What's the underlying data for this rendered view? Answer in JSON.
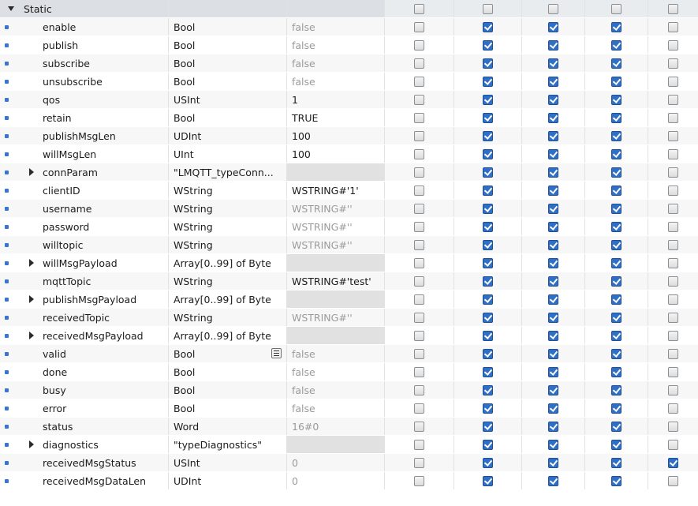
{
  "section": {
    "label": "Static"
  },
  "header_checks": [
    false,
    false,
    false,
    false,
    false
  ],
  "rows": [
    {
      "name": "enable",
      "type": "Bool",
      "default": "false",
      "def_style": "grey",
      "expandable": false,
      "checks": [
        false,
        true,
        true,
        true,
        false
      ]
    },
    {
      "name": "publish",
      "type": "Bool",
      "default": "false",
      "def_style": "grey",
      "expandable": false,
      "checks": [
        false,
        true,
        true,
        true,
        false
      ]
    },
    {
      "name": "subscribe",
      "type": "Bool",
      "default": "false",
      "def_style": "grey",
      "expandable": false,
      "checks": [
        false,
        true,
        true,
        true,
        false
      ]
    },
    {
      "name": "unsubscribe",
      "type": "Bool",
      "default": "false",
      "def_style": "grey",
      "expandable": false,
      "checks": [
        false,
        true,
        true,
        true,
        false
      ]
    },
    {
      "name": "qos",
      "type": "USInt",
      "default": "1",
      "def_style": "dark",
      "expandable": false,
      "checks": [
        false,
        true,
        true,
        true,
        false
      ]
    },
    {
      "name": "retain",
      "type": "Bool",
      "default": "TRUE",
      "def_style": "dark",
      "expandable": false,
      "checks": [
        false,
        true,
        true,
        true,
        false
      ]
    },
    {
      "name": "publishMsgLen",
      "type": "UDInt",
      "default": "100",
      "def_style": "dark",
      "expandable": false,
      "checks": [
        false,
        true,
        true,
        true,
        false
      ]
    },
    {
      "name": "willMsgLen",
      "type": "UInt",
      "default": "100",
      "def_style": "dark",
      "expandable": false,
      "checks": [
        false,
        true,
        true,
        true,
        false
      ]
    },
    {
      "name": "connParam",
      "type": "\"LMQTT_typeConn...",
      "default": "",
      "def_style": "struct",
      "expandable": true,
      "checks": [
        false,
        true,
        true,
        true,
        false
      ]
    },
    {
      "name": "clientID",
      "type": "WString",
      "default": "WSTRING#'1'",
      "def_style": "dark",
      "expandable": false,
      "checks": [
        false,
        true,
        true,
        true,
        false
      ]
    },
    {
      "name": "username",
      "type": "WString",
      "default": "WSTRING#''",
      "def_style": "grey",
      "expandable": false,
      "checks": [
        false,
        true,
        true,
        true,
        false
      ]
    },
    {
      "name": "password",
      "type": "WString",
      "default": "WSTRING#''",
      "def_style": "grey",
      "expandable": false,
      "checks": [
        false,
        true,
        true,
        true,
        false
      ]
    },
    {
      "name": "willtopic",
      "type": "WString",
      "default": "WSTRING#''",
      "def_style": "grey",
      "expandable": false,
      "checks": [
        false,
        true,
        true,
        true,
        false
      ]
    },
    {
      "name": "willMsgPayload",
      "type": "Array[0..99] of Byte",
      "default": "",
      "def_style": "struct",
      "expandable": true,
      "checks": [
        false,
        true,
        true,
        true,
        false
      ]
    },
    {
      "name": "mqttTopic",
      "type": "WString",
      "default": "WSTRING#'test'",
      "def_style": "dark",
      "expandable": false,
      "checks": [
        false,
        true,
        true,
        true,
        false
      ]
    },
    {
      "name": "publishMsgPayload",
      "type": "Array[0..99] of Byte",
      "default": "",
      "def_style": "struct",
      "expandable": true,
      "checks": [
        false,
        true,
        true,
        true,
        false
      ]
    },
    {
      "name": "receivedTopic",
      "type": "WString",
      "default": "WSTRING#''",
      "def_style": "grey",
      "expandable": false,
      "checks": [
        false,
        true,
        true,
        true,
        false
      ]
    },
    {
      "name": "receivedMsgPayload",
      "type": "Array[0..99] of Byte",
      "default": "",
      "def_style": "struct",
      "expandable": true,
      "checks": [
        false,
        true,
        true,
        true,
        false
      ]
    },
    {
      "name": "valid",
      "type": "Bool",
      "default": "false",
      "def_style": "grey",
      "expandable": false,
      "list_icon": true,
      "checks": [
        false,
        true,
        true,
        true,
        false
      ]
    },
    {
      "name": "done",
      "type": "Bool",
      "default": "false",
      "def_style": "grey",
      "expandable": false,
      "checks": [
        false,
        true,
        true,
        true,
        false
      ]
    },
    {
      "name": "busy",
      "type": "Bool",
      "default": "false",
      "def_style": "grey",
      "expandable": false,
      "checks": [
        false,
        true,
        true,
        true,
        false
      ]
    },
    {
      "name": "error",
      "type": "Bool",
      "default": "false",
      "def_style": "grey",
      "expandable": false,
      "checks": [
        false,
        true,
        true,
        true,
        false
      ]
    },
    {
      "name": "status",
      "type": "Word",
      "default": "16#0",
      "def_style": "grey",
      "expandable": false,
      "checks": [
        false,
        true,
        true,
        true,
        false
      ]
    },
    {
      "name": "diagnostics",
      "type": "\"typeDiagnostics\"",
      "default": "",
      "def_style": "struct",
      "expandable": true,
      "checks": [
        false,
        true,
        true,
        true,
        false
      ]
    },
    {
      "name": "receivedMsgStatus",
      "type": "USInt",
      "default": "0",
      "def_style": "grey",
      "expandable": false,
      "checks": [
        false,
        true,
        true,
        true,
        true
      ]
    },
    {
      "name": "receivedMsgDataLen",
      "type": "UDInt",
      "default": "0",
      "def_style": "grey",
      "expandable": false,
      "checks": [
        false,
        true,
        true,
        true,
        false
      ]
    }
  ]
}
